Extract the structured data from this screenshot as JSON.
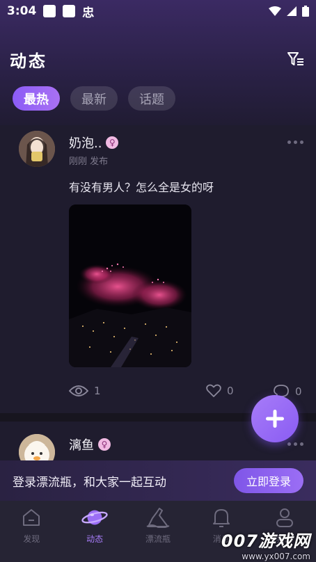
{
  "status_bar": {
    "time": "3:04",
    "glyph": "忠",
    "icons": [
      "wifi-icon",
      "signal-icon",
      "battery-icon"
    ]
  },
  "header": {
    "title": "动态",
    "filter_icon": "filter-icon"
  },
  "tabs": [
    {
      "label": "最热",
      "active": true
    },
    {
      "label": "最新",
      "active": false
    },
    {
      "label": "话题",
      "active": false
    }
  ],
  "posts": [
    {
      "username": "奶泡..",
      "gender_symbol": "♀",
      "time": "刚刚 发布",
      "text": "有没有男人？怎么全是女的呀",
      "image": "fireworks-photo",
      "views": "1",
      "likes": "0",
      "comments": "0"
    },
    {
      "username": "漓鱼",
      "gender_symbol": "♀"
    }
  ],
  "login_banner": {
    "message": "登录漂流瓶，和大家一起互动",
    "button": "立即登录"
  },
  "bottom_nav": [
    {
      "label": "发现",
      "icon": "home-icon",
      "active": false
    },
    {
      "label": "动态",
      "icon": "planet-icon",
      "active": true
    },
    {
      "label": "漂流瓶",
      "icon": "bottle-icon",
      "active": false
    },
    {
      "label": "消息",
      "icon": "bell-icon",
      "active": false
    },
    {
      "label": "我的",
      "icon": "person-icon",
      "active": false
    }
  ],
  "watermark": {
    "main": "007游戏网",
    "url": "www.yx007.com"
  },
  "colors": {
    "accent": "#8b5cf6",
    "background": "#1c1a2a",
    "header_gradient_top": "#3b2a63"
  }
}
